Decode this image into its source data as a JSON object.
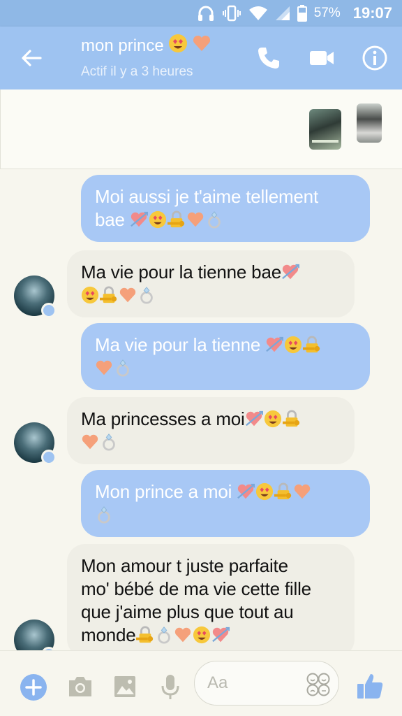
{
  "status_bar": {
    "battery_percent": "57%",
    "time": "19:07",
    "icons": [
      "headphones-icon",
      "vibrate-icon",
      "wifi-icon",
      "signal-icon",
      "battery-icon"
    ]
  },
  "header": {
    "contact_name": "mon prince",
    "name_emojis": [
      "heart-eyes-emoji",
      "orange-heart-emoji"
    ],
    "status": "Actif il y a 3 heures",
    "icons": [
      "back-arrow-icon",
      "phone-icon",
      "video-camera-icon",
      "info-icon"
    ]
  },
  "shared_media": [
    "shared-photo-1",
    "shared-photo-2"
  ],
  "messages": [
    {
      "direction": "outgoing",
      "lines": [
        "Moi aussi je t'aime tellement",
        "bae"
      ],
      "emojis": [
        "heart-arrow-emoji",
        "heart-eyes-emoji",
        "lock-key-emoji",
        "orange-heart-emoji",
        "ring-emoji"
      ]
    },
    {
      "direction": "incoming",
      "lines": [
        "Ma vie pour la tienne bae"
      ],
      "emojis": [
        "heart-arrow-emoji",
        "heart-eyes-emoji",
        "lock-key-emoji",
        "orange-heart-emoji",
        "ring-emoji"
      ]
    },
    {
      "direction": "outgoing",
      "lines": [
        "Ma vie pour la tienne"
      ],
      "emojis": [
        "heart-arrow-emoji",
        "heart-eyes-emoji",
        "lock-key-emoji",
        "orange-heart-emoji",
        "ring-emoji"
      ]
    },
    {
      "direction": "incoming",
      "lines": [
        "Ma princesses a moi"
      ],
      "emojis": [
        "heart-arrow-emoji",
        "heart-eyes-emoji",
        "lock-key-emoji",
        "orange-heart-emoji",
        "ring-emoji"
      ]
    },
    {
      "direction": "outgoing",
      "lines": [
        "Mon prince a moi"
      ],
      "emojis": [
        "heart-arrow-emoji",
        "heart-eyes-emoji",
        "lock-key-emoji",
        "orange-heart-emoji",
        "ring-emoji"
      ]
    },
    {
      "direction": "incoming",
      "lines": [
        "Mon amour t juste parfaite",
        "mo' bébé de ma vie cette fille",
        "que j'aime plus que tout au",
        "monde"
      ],
      "emojis": [
        "lock-key-emoji",
        "ring-emoji",
        "orange-heart-emoji",
        "heart-eyes-emoji",
        "heart-arrow-emoji"
      ]
    }
  ],
  "composer": {
    "placeholder": "Aa",
    "icons": [
      "plus-icon",
      "camera-icon",
      "gallery-icon",
      "microphone-icon",
      "emoji-icon",
      "thumbs-up-icon"
    ]
  },
  "colors": {
    "header": "#9ec3f1",
    "status_bar": "#8fb8e6",
    "outgoing_bubble": "#a8c8f5",
    "incoming_bubble": "#efeee6",
    "background": "#f7f6ee",
    "accent": "#8ab4ef"
  }
}
